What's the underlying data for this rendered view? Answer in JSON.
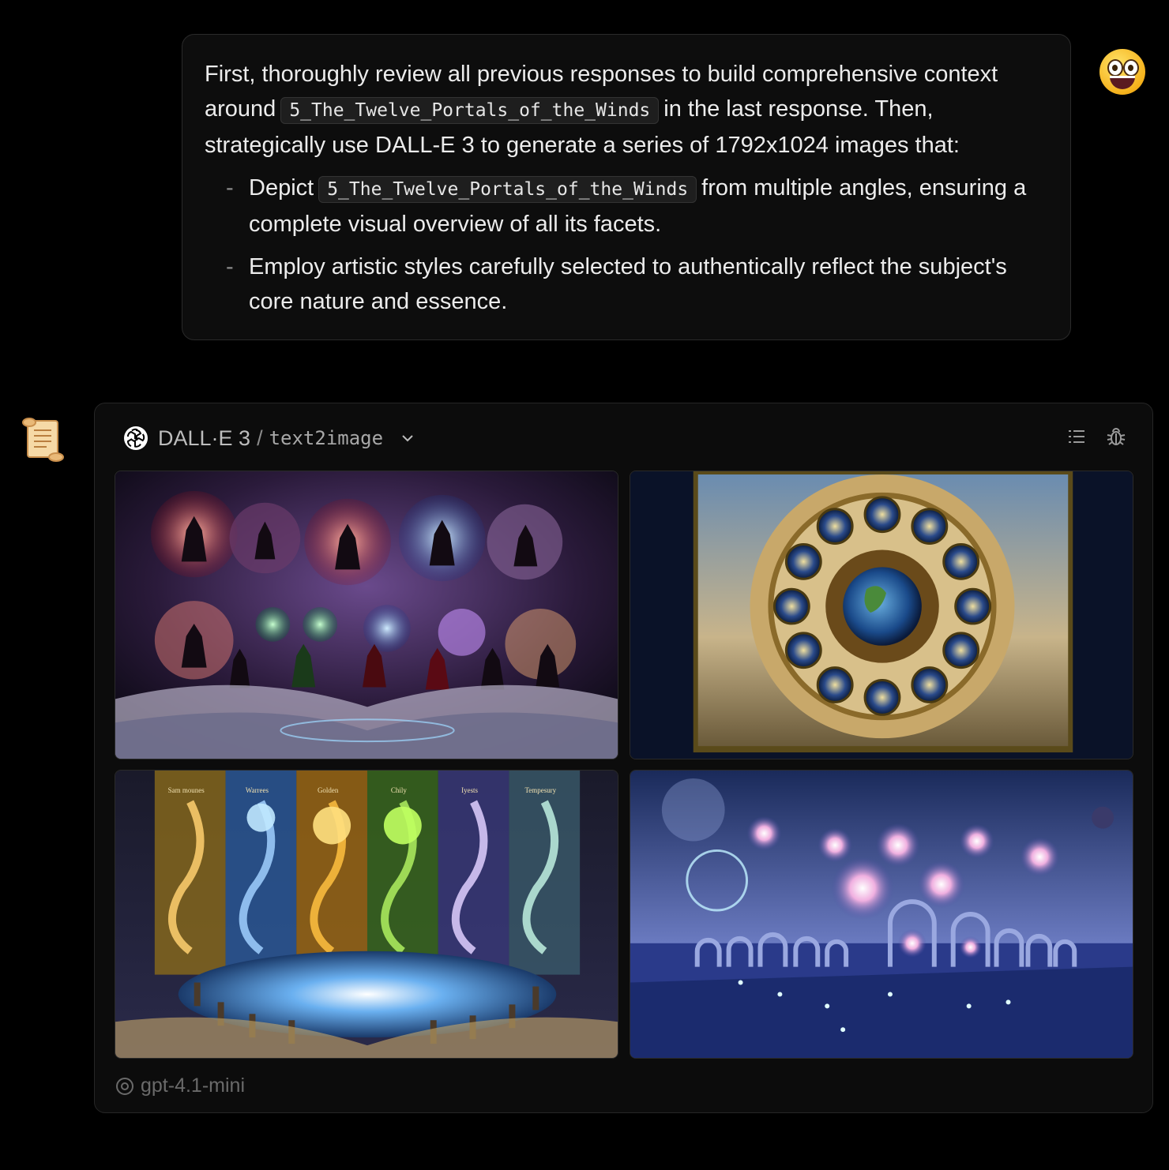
{
  "user_message": {
    "intro_1": "First, thoroughly review all previous responses to build comprehensive context around",
    "code_ref": "5_The_Twelve_Portals_of_the_Winds",
    "intro_2": "in the last response. Then, strategically use DALL-E 3 to generate a series of 1792x1024 images that:",
    "bullets": [
      {
        "dash": "-",
        "before": "Depict",
        "code": "5_The_Twelve_Portals_of_the_Winds",
        "after": "from multiple angles, ensuring a complete visual overview of all its facets."
      },
      {
        "dash": "-",
        "text": "Employ artistic styles carefully selected to authentically reflect the subject's core nature and essence."
      }
    ]
  },
  "tool_card": {
    "model": "DALL·E 3",
    "separator": "/",
    "tool": "text2image",
    "icons": [
      "list-icon",
      "bug-icon",
      "chevron-down-icon",
      "openai-logo-icon"
    ],
    "images": [
      {
        "name": "generated-image-1"
      },
      {
        "name": "generated-image-2"
      },
      {
        "name": "generated-image-3",
        "banner_labels": [
          "Sam mounes",
          "Warrees",
          "Golden",
          "Chily",
          "Iyests",
          "Tempesury"
        ]
      },
      {
        "name": "generated-image-4"
      }
    ],
    "footer_model": "gpt-4.1-mini"
  },
  "colors": {
    "background": "#000000",
    "bubble": "#0d0d0d",
    "card": "#0c0c0c",
    "text": "#ececec",
    "muted": "#6a6a6a"
  }
}
